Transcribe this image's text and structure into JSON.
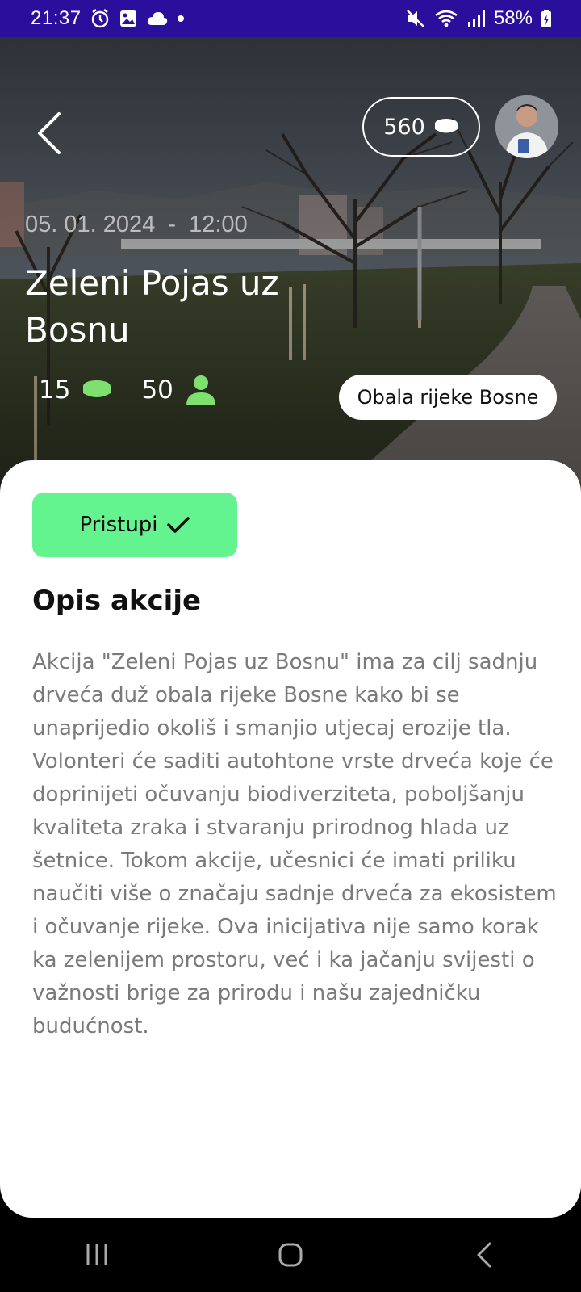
{
  "status_bar": {
    "time": "21:37",
    "battery": "58%"
  },
  "header": {
    "coins": "560"
  },
  "event": {
    "date": "05. 01. 2024",
    "separator": "-",
    "time": "12:00",
    "title": "Zeleni Pojas uz Bosnu",
    "reward": "15",
    "participants": "50",
    "location": "Obala rijeke Bosne"
  },
  "actions": {
    "join_label": "Pristupi"
  },
  "description": {
    "title": "Opis akcije",
    "text": "Akcija \"Zeleni Pojas uz Bosnu\" ima za cilj sadnju drveća duž obala rijeke Bosne kako bi se unaprijedio okoliš i smanjio utjecaj erozije tla. Volonteri će saditi autohtone vrste drveća koje će doprinijeti očuvanju biodiverziteta, poboljšanju kvaliteta zraka i stvaranju prirodnog hlada uz šetnice. Tokom akcije, učesnici će imati priliku naučiti više o značaju sadnje drveća za ekosistem i očuvanje rijeke. Ova inicijativa nije samo korak ka zelenijem prostoru, već i ka jačanju svijesti o važnosti brige za prirodu i našu zajedničku budućnost."
  },
  "colors": {
    "status_bar": "#2a0e9c",
    "accent_green": "#63f38f",
    "icon_green": "#7ee06e"
  }
}
